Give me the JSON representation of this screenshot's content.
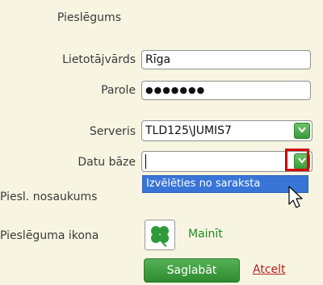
{
  "header": {
    "title": "Pieslēgums"
  },
  "fields": {
    "username": {
      "label": "Lietotājvārds",
      "value": "Rīga"
    },
    "password": {
      "label": "Parole",
      "value": "●●●●●●●"
    },
    "server": {
      "label": "Serveris",
      "value": "TLD125\\JUMIS7"
    },
    "database": {
      "label": "Datu bāze",
      "value": ""
    },
    "connection_name": {
      "label": "Piesl. nosaukums"
    },
    "connection_icon": {
      "label": "Pieslēguma ikona",
      "change_label": "Mainīt"
    }
  },
  "dropdown": {
    "options": [
      "Izvēlēties no saraksta"
    ]
  },
  "actions": {
    "save_label": "Saglabāt",
    "cancel_label": "Atcelt"
  },
  "colors": {
    "accent_green": "#3a9b3a",
    "highlight_red": "#d40000",
    "selection_blue": "#3875d7"
  }
}
